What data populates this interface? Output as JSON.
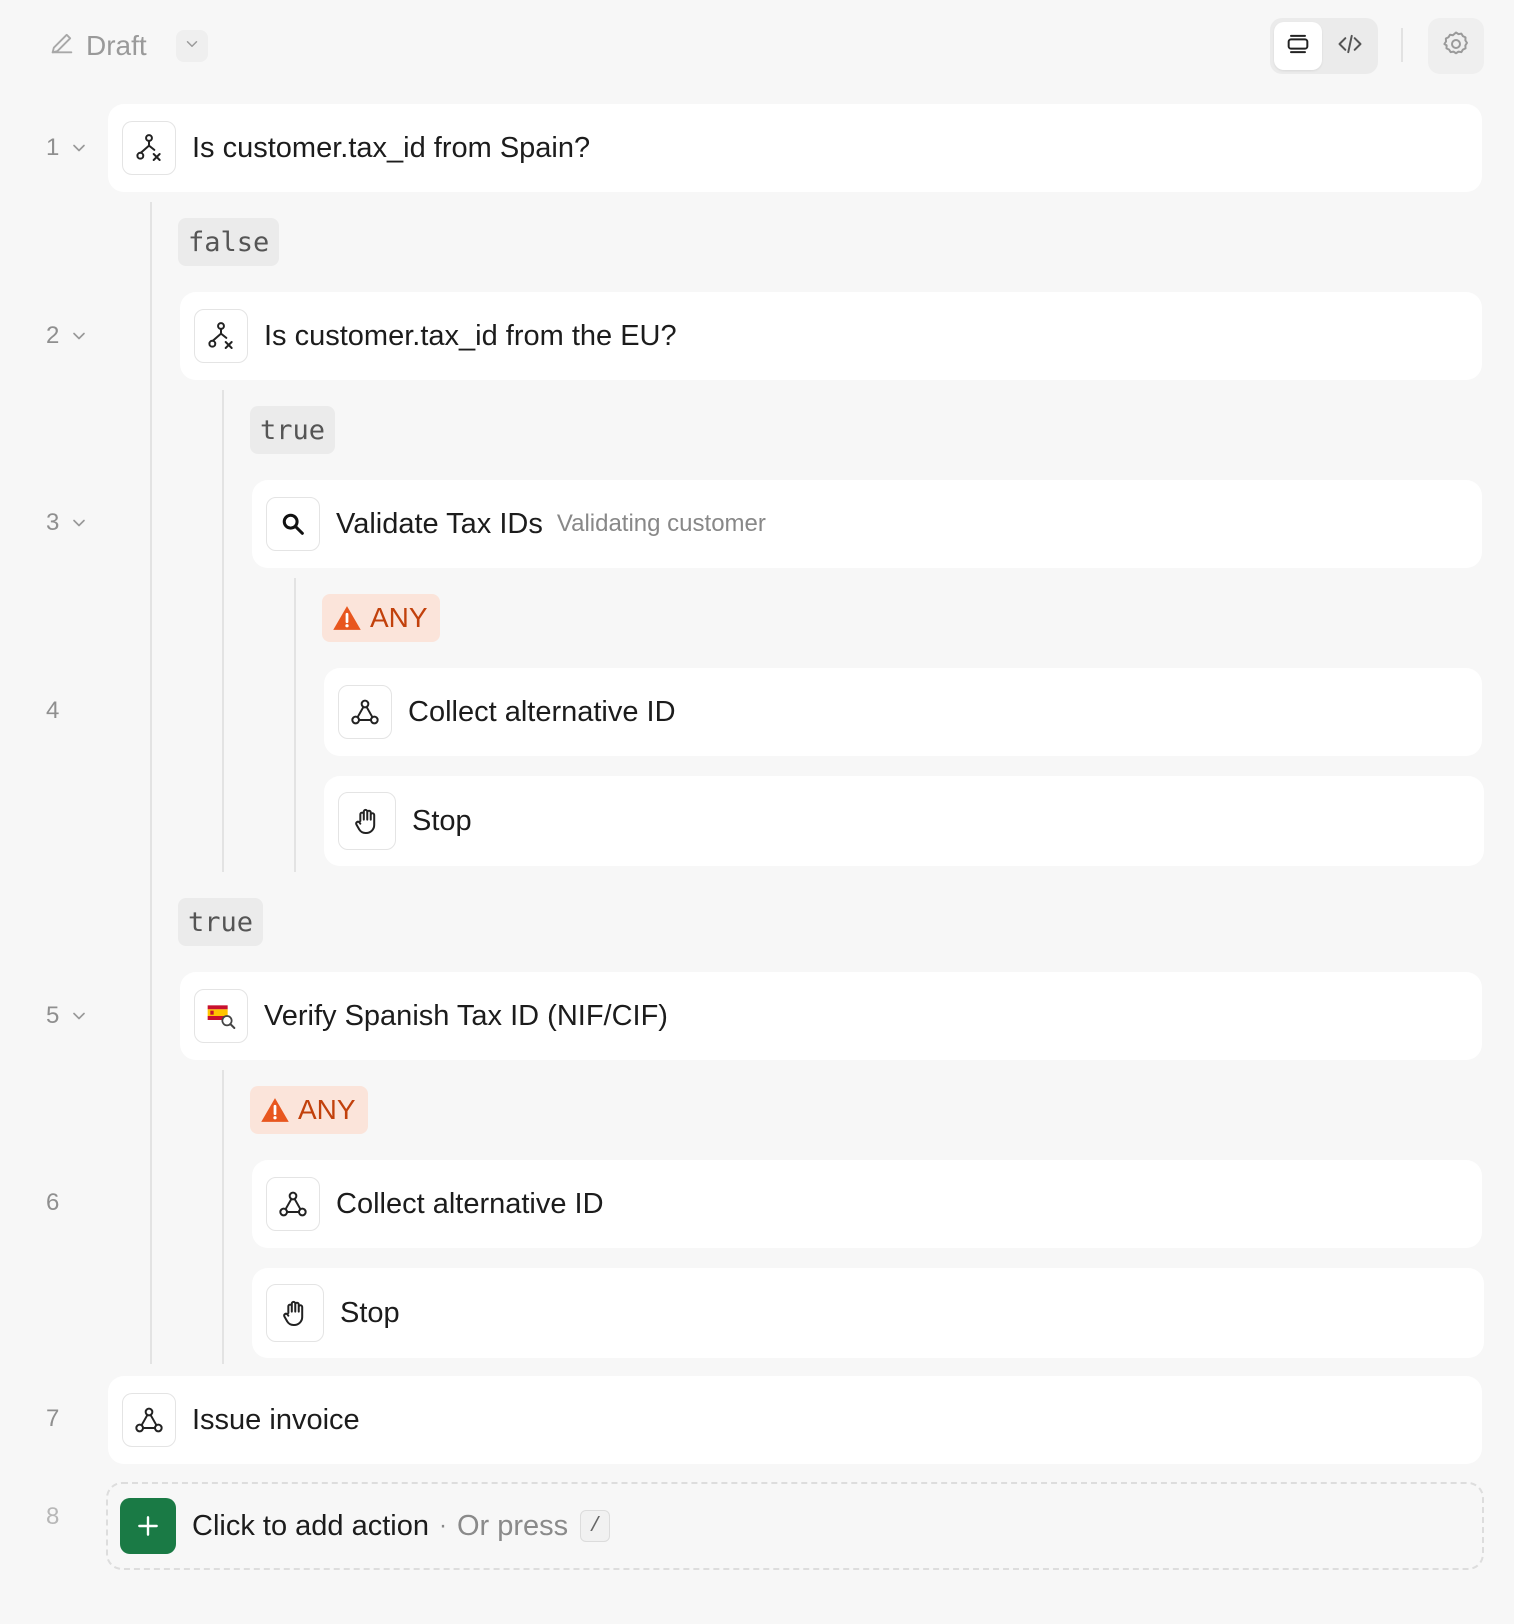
{
  "header": {
    "status_label": "Draft",
    "view_toggle": [
      "visual-view",
      "code-view"
    ],
    "settings_icon": "gear-icon"
  },
  "steps": [
    {
      "number": "1",
      "title": "Is customer.tax_id from Spain?",
      "icon": "branch-icon"
    },
    {
      "number": "2",
      "title": "Is customer.tax_id from the EU?",
      "icon": "branch-icon"
    },
    {
      "number": "3",
      "title": "Validate Tax IDs",
      "subtitle": "Validating customer",
      "icon": "search-icon"
    },
    {
      "number": "4",
      "actions": [
        {
          "title": "Collect alternative ID",
          "icon": "webhook-icon"
        },
        {
          "title": "Stop",
          "icon": "hand-stop-icon"
        }
      ]
    },
    {
      "number": "5",
      "title": "Verify Spanish Tax ID (NIF/CIF)",
      "icon": "spain-flag-search-icon"
    },
    {
      "number": "6",
      "actions": [
        {
          "title": "Collect alternative ID",
          "icon": "webhook-icon"
        },
        {
          "title": "Stop",
          "icon": "hand-stop-icon"
        }
      ]
    },
    {
      "number": "7",
      "title": "Issue invoice",
      "icon": "webhook-icon"
    },
    {
      "number": "8"
    }
  ],
  "branches": {
    "false_label": "false",
    "true_label": "true",
    "any_label": "ANY"
  },
  "add_action": {
    "label": "Click to add action",
    "separator": "·",
    "hint": "Or press",
    "shortcut": "/"
  },
  "colors": {
    "accent_green": "#1a7a45",
    "warning_orange": "#c2410c",
    "warning_bg": "#fbe4da"
  }
}
